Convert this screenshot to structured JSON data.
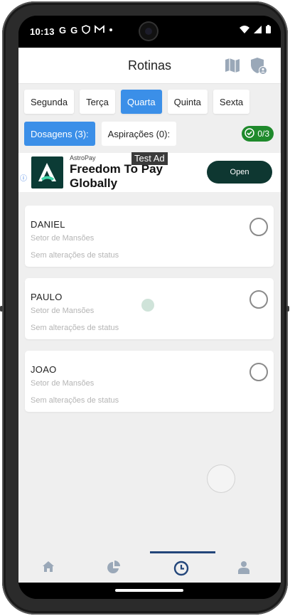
{
  "status_bar": {
    "time": "10:13",
    "notification_letters": [
      "G",
      "G"
    ],
    "notification_icons": [
      "google-icon",
      "google-icon",
      "shield-icon",
      "gmail-icon",
      "dot-icon"
    ],
    "system_icons": [
      "wifi-icon",
      "signal-icon",
      "battery-icon"
    ]
  },
  "header": {
    "title": "Rotinas",
    "icons": [
      "map-icon",
      "admin-shield-user-icon"
    ]
  },
  "days": [
    {
      "label": "Segunda",
      "active": false
    },
    {
      "label": "Terça",
      "active": false
    },
    {
      "label": "Quarta",
      "active": true
    },
    {
      "label": "Quinta",
      "active": false
    },
    {
      "label": "Sexta",
      "active": false
    }
  ],
  "tabs": [
    {
      "label": "Dosagens (3):",
      "active": true
    },
    {
      "label": "Aspirações (0):",
      "active": false
    }
  ],
  "counter": {
    "label": "0/3",
    "color": "#1f8a2c"
  },
  "ad": {
    "test_label": "Test Ad",
    "brand": "AstroPay",
    "headline": "Freedom To Pay Globally",
    "cta": "Open"
  },
  "patients": [
    {
      "name": "DANIEL",
      "sector": "Setor de Mansões",
      "status": "Sem alterações de status",
      "checked": false
    },
    {
      "name": "PAULO",
      "sector": "Setor de Mansões",
      "status": "Sem alterações de status",
      "checked": false
    },
    {
      "name": "JOAO",
      "sector": "Setor de Mansões",
      "status": "Sem alterações de status",
      "checked": false
    }
  ],
  "bottom_nav": [
    {
      "icon": "home-icon",
      "active": false
    },
    {
      "icon": "pie-chart-icon",
      "active": false
    },
    {
      "icon": "clock-icon",
      "active": true
    },
    {
      "icon": "user-icon",
      "active": false
    }
  ],
  "colors": {
    "accent": "#3b8fe8",
    "success": "#1f8a2c",
    "nav_active": "#23467a",
    "ad_dark": "#0e3731"
  }
}
